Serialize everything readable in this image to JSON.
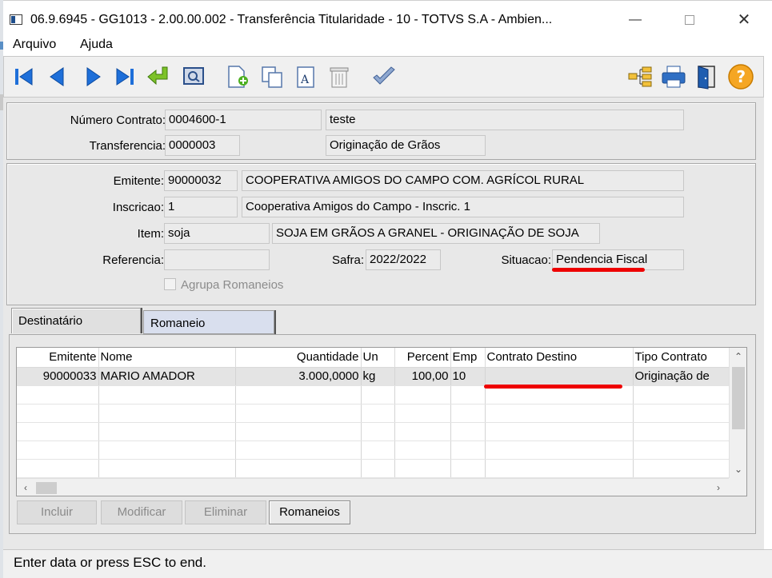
{
  "window": {
    "title": "06.9.6945 - GG1013 - 2.00.00.002 - Transferência Titularidade - 10 - TOTVS S.A - Ambien...",
    "minimize": "—",
    "close": "✕"
  },
  "menu": {
    "items": [
      "Arquivo",
      "Ajuda"
    ]
  },
  "header": {
    "numero_contrato_label": "Número Contrato:",
    "numero_contrato": "0004600-1",
    "descricao": "teste",
    "transferencia_label": "Transferencia:",
    "transferencia": "0000003",
    "tipo": "Originação de Grãos"
  },
  "details": {
    "emitente_label": "Emitente:",
    "emitente_code": "90000032",
    "emitente_name": "COOPERATIVA AMIGOS DO CAMPO COM. AGRÍCOL RURAL",
    "inscricao_label": "Inscricao:",
    "inscricao_code": "1",
    "inscricao_name": "Cooperativa Amigos do Campo - Inscric. 1",
    "item_label": "Item:",
    "item_code": "soja",
    "item_desc": "SOJA EM GRÃOS A GRANEL - ORIGINAÇÃO DE SOJA",
    "referencia_label": "Referencia:",
    "referencia": "",
    "safra_label": "Safra:",
    "safra": "2022/2022",
    "situacao_label": "Situacao:",
    "situacao": "Pendencia Fiscal",
    "agrupa_label": "Agrupa Romaneios"
  },
  "tabs": [
    "Destinatário",
    "Romaneio"
  ],
  "grid": {
    "columns": [
      "Emitente",
      "Nome",
      "Quantidade",
      "Un",
      "Percent",
      "Emp",
      "Contrato Destino",
      "Tipo Contrato"
    ],
    "rows": [
      [
        "90000033",
        "MARIO AMADOR",
        "3.000,0000",
        "kg",
        "100,00",
        "10",
        "",
        "Originação de"
      ]
    ]
  },
  "buttons": {
    "incluir": "Incluir",
    "modificar": "Modificar",
    "eliminar": "Eliminar",
    "romaneios": "Romaneios"
  },
  "status": {
    "text": "Enter data or press ESC to end."
  },
  "colors": {
    "highlight_red": "#ee0000",
    "tab_blue": "#d9dfee",
    "help_orange": "#f5a623"
  }
}
